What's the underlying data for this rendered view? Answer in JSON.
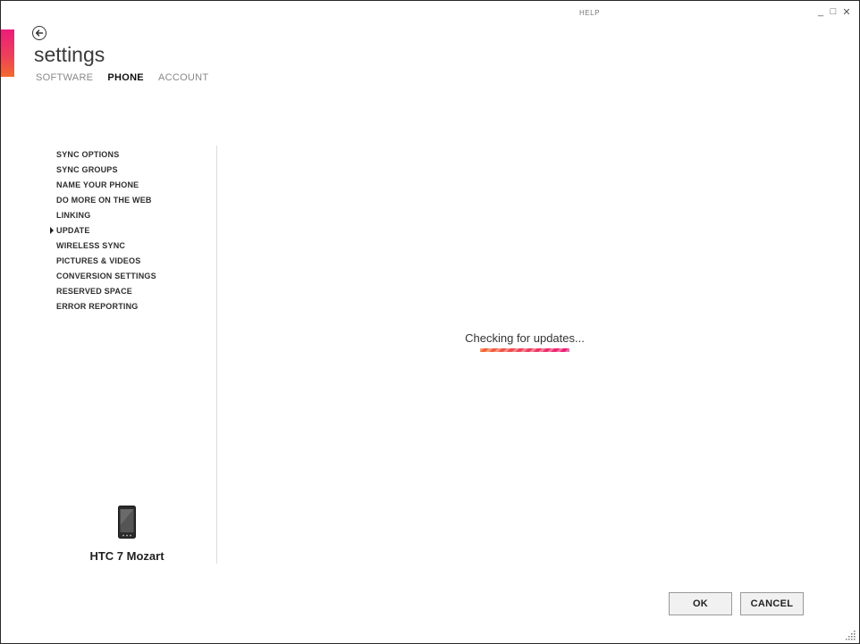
{
  "window": {
    "help_label": "HELP",
    "minimize_glyph": "_",
    "maximize_glyph": "□",
    "close_glyph": "✕"
  },
  "header": {
    "title": "settings",
    "tabs": [
      {
        "label": "SOFTWARE",
        "active": false
      },
      {
        "label": "PHONE",
        "active": true
      },
      {
        "label": "ACCOUNT",
        "active": false
      }
    ]
  },
  "sidebar": {
    "items": [
      {
        "label": "SYNC OPTIONS"
      },
      {
        "label": "SYNC GROUPS"
      },
      {
        "label": "NAME YOUR PHONE"
      },
      {
        "label": "DO MORE ON THE WEB"
      },
      {
        "label": "LINKING"
      },
      {
        "label": "UPDATE",
        "selected": true
      },
      {
        "label": "WIRELESS SYNC"
      },
      {
        "label": "PICTURES & VIDEOS"
      },
      {
        "label": "CONVERSION SETTINGS"
      },
      {
        "label": "RESERVED SPACE"
      },
      {
        "label": "ERROR REPORTING"
      }
    ],
    "device": {
      "name": "HTC 7 Mozart",
      "icon": "phone-icon"
    }
  },
  "main": {
    "status_text": "Checking for updates...",
    "progress": "indeterminate"
  },
  "footer": {
    "ok_label": "OK",
    "cancel_label": "CANCEL"
  },
  "colors": {
    "accent_pink": "#ec1c7a",
    "accent_orange": "#f26a2d"
  }
}
